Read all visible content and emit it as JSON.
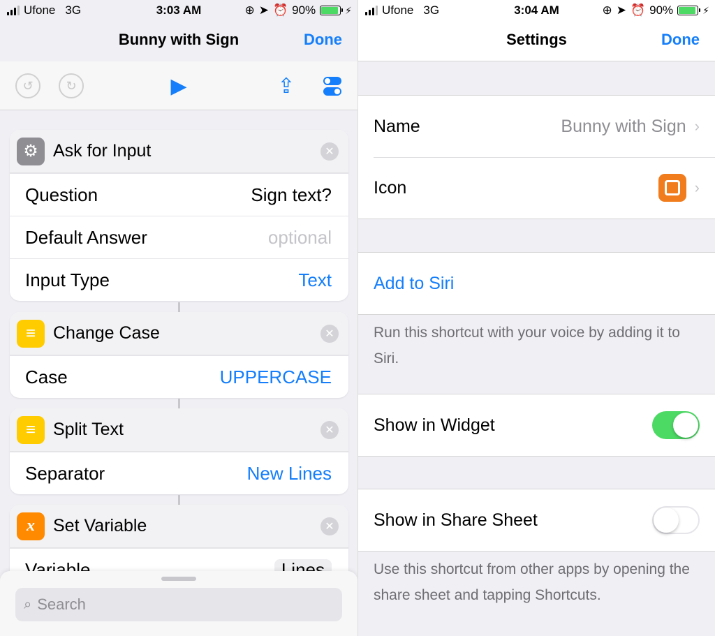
{
  "left": {
    "status": {
      "carrier": "Ufone",
      "network": "3G",
      "time": "3:03 AM",
      "battery": "90%"
    },
    "nav": {
      "title": "Bunny with Sign",
      "done": "Done"
    },
    "actions": [
      {
        "title": "Ask for Input",
        "icon": "gear-icon",
        "rows": [
          {
            "label": "Question",
            "value": "Sign text?"
          },
          {
            "label": "Default Answer",
            "value": "optional"
          },
          {
            "label": "Input Type",
            "value": "Text"
          }
        ]
      },
      {
        "title": "Change Case",
        "icon": "text-lines-icon",
        "rows": [
          {
            "label": "Case",
            "value": "UPPERCASE"
          }
        ]
      },
      {
        "title": "Split Text",
        "icon": "text-lines-icon",
        "rows": [
          {
            "label": "Separator",
            "value": "New Lines"
          }
        ]
      },
      {
        "title": "Set Variable",
        "icon": "variable-x-icon",
        "glyph": "x",
        "rows": [
          {
            "label": "Variable",
            "value": "Lines"
          }
        ]
      }
    ],
    "search": {
      "placeholder": "Search"
    }
  },
  "right": {
    "status": {
      "carrier": "Ufone",
      "network": "3G",
      "time": "3:04 AM",
      "battery": "90%"
    },
    "nav": {
      "title": "Settings",
      "done": "Done"
    },
    "name": {
      "label": "Name",
      "value": "Bunny with Sign"
    },
    "icon": {
      "label": "Icon"
    },
    "siri": {
      "label": "Add to Siri",
      "footer": "Run this shortcut with your voice by adding it to Siri."
    },
    "widget": {
      "label": "Show in Widget",
      "on": true
    },
    "share": {
      "label": "Show in Share Sheet",
      "on": false,
      "footer": "Use this shortcut from other apps by opening the share sheet and tapping Shortcuts."
    }
  },
  "colors": {
    "accent": "#147efb",
    "switch_on": "#4cd964",
    "icon_orange": "#f07c1e"
  }
}
